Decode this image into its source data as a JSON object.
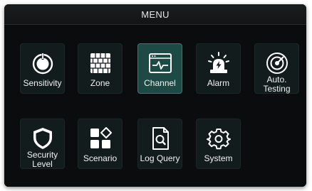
{
  "header": {
    "title": "MENU"
  },
  "menu": {
    "items": [
      {
        "label": "Sensitivity",
        "icon": "power-knob-icon"
      },
      {
        "label": "Zone",
        "icon": "zone-wall-icon"
      },
      {
        "label": "Channel",
        "icon": "channel-waveform-icon",
        "selected": true
      },
      {
        "label": "Alarm",
        "icon": "alarm-siren-icon"
      },
      {
        "label": "Auto.\nTesting",
        "icon": "radar-icon"
      },
      {
        "label": "Security\nLevel",
        "icon": "shield-icon"
      },
      {
        "label": "Scenario",
        "icon": "scenario-blocks-icon"
      },
      {
        "label": "Log Query",
        "icon": "document-search-icon"
      },
      {
        "label": "System",
        "icon": "gear-icon"
      }
    ]
  },
  "colors": {
    "background": "#0b0c0d",
    "tile": "#121c1c",
    "tile_selected": "#1d4a45",
    "text": "#f2f2f2"
  }
}
